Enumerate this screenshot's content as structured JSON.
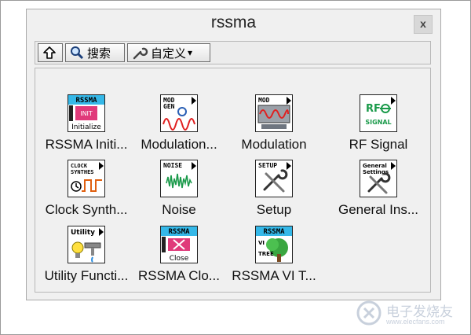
{
  "window": {
    "title": "rssma",
    "close_glyph": "x"
  },
  "toolbar": {
    "up_icon": "up-arrow-icon",
    "search_label": "搜索",
    "customize_label": "自定义",
    "customize_arrow": "▾"
  },
  "items": [
    {
      "label": "RSSMA Initi...",
      "icon": "rssma-initialize-icon",
      "icon_text": [
        "RSSMA",
        "INIT",
        "Initialize"
      ]
    },
    {
      "label": "Modulation...",
      "icon": "mod-gen-icon",
      "icon_text": [
        "MOD",
        "GEN"
      ]
    },
    {
      "label": "Modulation",
      "icon": "mod-icon",
      "icon_text": [
        "MOD"
      ]
    },
    {
      "label": "RF Signal",
      "icon": "rf-signal-icon",
      "icon_text": [
        "RF",
        "SIGNAL"
      ]
    },
    {
      "label": "Clock Synth...",
      "icon": "clock-synthesis-icon",
      "icon_text": [
        "CLOCK",
        "SYNTHES"
      ]
    },
    {
      "label": "Noise",
      "icon": "noise-icon",
      "icon_text": [
        "NOISE"
      ]
    },
    {
      "label": "Setup",
      "icon": "setup-icon",
      "icon_text": [
        "SETUP"
      ]
    },
    {
      "label": "General Ins...",
      "icon": "general-settings-icon",
      "icon_text": [
        "General",
        "Settings"
      ]
    },
    {
      "label": "Utility Functi...",
      "icon": "utility-icon",
      "icon_text": [
        "Utility"
      ]
    },
    {
      "label": "RSSMA Clo...",
      "icon": "rssma-close-icon",
      "icon_text": [
        "RSSMA",
        "Close"
      ]
    },
    {
      "label": "RSSMA VI T...",
      "icon": "rssma-vi-tree-icon",
      "icon_text": [
        "RSSMA",
        "VI",
        "TREE"
      ]
    }
  ],
  "watermark": {
    "text": "电子发烧友",
    "url_text": "www.elecfans.com"
  },
  "colors": {
    "window_bg": "#f0f0f0",
    "accent_cyan": "#35b8e8",
    "icon_blue": "#2a5fb4",
    "icon_green": "#1a9a4a"
  }
}
